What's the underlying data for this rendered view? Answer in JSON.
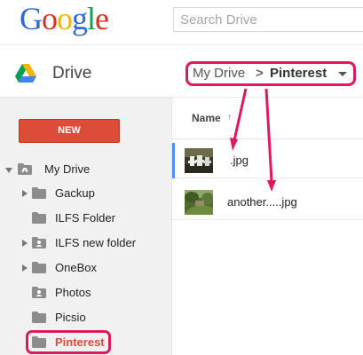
{
  "header": {
    "logo_letters": [
      {
        "char": "G",
        "color": "#3367d6"
      },
      {
        "char": "o",
        "color": "#d93025"
      },
      {
        "char": "o",
        "color": "#f4b400"
      },
      {
        "char": "g",
        "color": "#3367d6"
      },
      {
        "char": "l",
        "color": "#0f9d58"
      },
      {
        "char": "e",
        "color": "#d93025"
      }
    ],
    "search_placeholder": "Search Drive"
  },
  "appbar": {
    "title": "Drive",
    "breadcrumb": {
      "root": "My Drive",
      "separator": ">",
      "current": "Pinterest"
    }
  },
  "sidebar": {
    "new_label": "NEW",
    "items": [
      {
        "label": "My Drive",
        "icon": "my-drive-icon",
        "arrow": "down"
      },
      {
        "label": "Gackup",
        "icon": "folder-icon",
        "arrow": "right"
      },
      {
        "label": "ILFS Folder",
        "icon": "folder-icon",
        "arrow": "none"
      },
      {
        "label": "ILFS new folder",
        "icon": "shared-folder-icon",
        "arrow": "right"
      },
      {
        "label": "OneBox",
        "icon": "folder-icon",
        "arrow": "right"
      },
      {
        "label": "Photos",
        "icon": "shared-folder-icon",
        "arrow": "none"
      },
      {
        "label": "Picsio",
        "icon": "folder-icon",
        "arrow": "none"
      },
      {
        "label": "Pinterest",
        "icon": "folder-icon",
        "arrow": "none",
        "selected": true
      }
    ]
  },
  "main": {
    "column_header": "Name",
    "sort_indicator": "↑",
    "files": [
      {
        "name": ".jpg",
        "thumb": "image-thumbnail-chairs"
      },
      {
        "name": "another.....jpg",
        "thumb": "image-thumbnail-garden"
      }
    ]
  },
  "colors": {
    "accent_red": "#dd4b39",
    "highlight": "#e0195a",
    "selection_blue": "#4d90fe",
    "sidebar_bg": "#f1f1f1"
  }
}
